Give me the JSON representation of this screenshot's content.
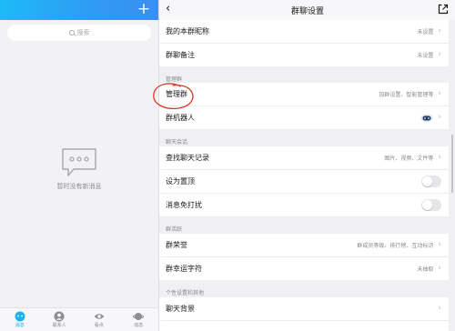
{
  "left": {
    "search_placeholder": "搜索",
    "empty_text": "暂时没有新消息",
    "tabs": [
      {
        "label": "消息",
        "icon": "message-icon",
        "active": true
      },
      {
        "label": "联系人",
        "icon": "contacts-icon",
        "active": false
      },
      {
        "label": "看点",
        "icon": "eye-icon",
        "active": false
      },
      {
        "label": "动态",
        "icon": "planet-icon",
        "active": false
      }
    ]
  },
  "header": {
    "title": "群聊设置"
  },
  "rows": {
    "nickname": {
      "label": "我的本群昵称",
      "value": "未设置"
    },
    "remark": {
      "label": "群聊备注",
      "value": "未设置"
    },
    "manage": {
      "label": "管理群",
      "value": "加群设置、智能管理等"
    },
    "robot": {
      "label": "群机器人"
    },
    "history": {
      "label": "查找聊天记录",
      "value": "图片、视频、文件等"
    },
    "pin": {
      "label": "设为置顶",
      "toggle": false
    },
    "mute": {
      "label": "消息免打扰",
      "toggle": false
    },
    "honor": {
      "label": "群荣誉",
      "value": "群成员等级、排行榜、互动标识"
    },
    "lucky": {
      "label": "群幸运字符",
      "value": "未抽取"
    },
    "bg": {
      "label": "聊天背景"
    }
  },
  "sections": {
    "manage": "管理群",
    "chat": "聊天会话",
    "active": "群活跃",
    "personal": "个性设置和其他"
  },
  "colors": {
    "accent": "#16a5ee",
    "annotation": "#d93a2b",
    "toggle_off": "#e5e5ea"
  }
}
